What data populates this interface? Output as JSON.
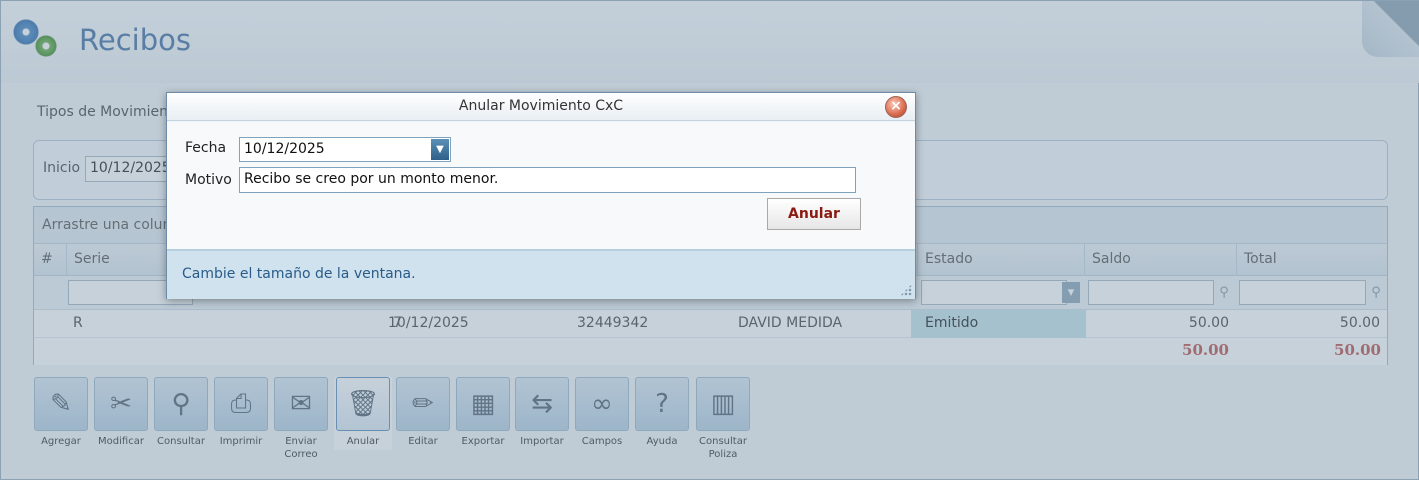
{
  "app": {
    "title": "Recibos"
  },
  "filters": {
    "label": "Tipos de Movimiento",
    "inicio_label": "Inicio",
    "inicio_value": "10/12/2025"
  },
  "grid": {
    "group_hint": "Arrastre una columna",
    "columns": [
      "#",
      "Serie",
      "",
      "",
      "",
      "",
      "Estado",
      "Saldo",
      "Total"
    ],
    "rows": [
      {
        "num": "",
        "serie": "R",
        "folio": "7",
        "fecha": "10/12/2025",
        "ref": "32449342",
        "cliente": "DAVID MEDIDA",
        "estado": "Emitido",
        "saldo": "50.00",
        "total": "50.00"
      }
    ],
    "totals": {
      "saldo": "50.00",
      "total": "50.00"
    }
  },
  "toolbar": {
    "buttons": [
      {
        "label": "Agregar",
        "icon": "add-document-icon"
      },
      {
        "label": "Modificar",
        "icon": "edit-tools-icon"
      },
      {
        "label": "Consultar",
        "icon": "magnifier-icon"
      },
      {
        "label": "Imprimir",
        "icon": "printer-icon"
      },
      {
        "label": "Enviar Correo",
        "icon": "envelope-icon"
      },
      {
        "label": "Anular",
        "icon": "trash-can-icon"
      },
      {
        "label": "Editar",
        "icon": "pencil-icon"
      },
      {
        "label": "Exportar",
        "icon": "export-icon"
      },
      {
        "label": "Importar",
        "icon": "import-icon"
      },
      {
        "label": "Campos",
        "icon": "binoculars-icon"
      },
      {
        "label": "Ayuda",
        "icon": "help-icon"
      },
      {
        "label": "Consultar Poliza",
        "icon": "books-icon"
      }
    ]
  },
  "dialog": {
    "title": "Anular Movimiento CxC",
    "fecha_label": "Fecha",
    "fecha_value": "10/12/2025",
    "motivo_label": "Motivo",
    "motivo_value": "Recibo se creo por un monto menor.",
    "anular_label": "Anular",
    "footer_text": "Cambie el tamaño de la ventana."
  }
}
